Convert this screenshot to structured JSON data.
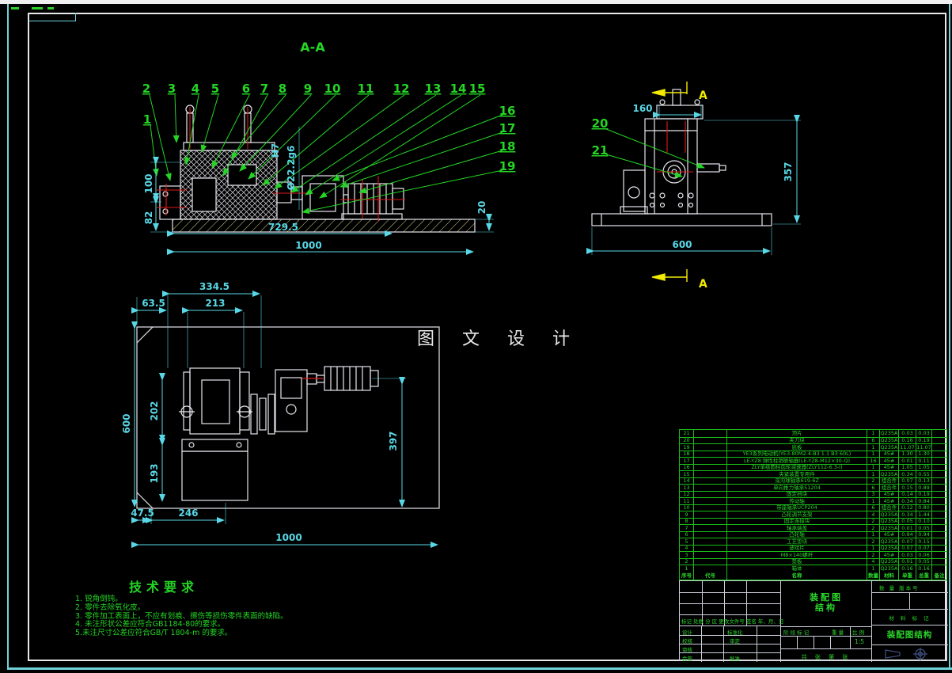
{
  "drawing": {
    "section": {
      "title": "A-A",
      "callouts": [
        "1",
        "2",
        "3",
        "4",
        "5",
        "6",
        "7",
        "8",
        "9",
        "10",
        "11",
        "12",
        "13",
        "14",
        "15",
        "16",
        "17",
        "18",
        "19"
      ],
      "dims": {
        "left_upper": "100",
        "left_lower": "82",
        "bottom_inner": "729.5",
        "bottom_outer": "1000",
        "right_thk": "20",
        "fit_upper": "H7",
        "fit_bore": "Ø22.2g6"
      }
    },
    "side": {
      "callouts": [
        "20",
        "21"
      ],
      "dims": {
        "top": "160",
        "right": "357",
        "bottom": "600"
      },
      "mark": "A"
    },
    "plan": {
      "dims": {
        "top_outer": "334.5",
        "top_left": "63.5",
        "top_right": "213",
        "left_outer": "600",
        "left_mid": "202",
        "left_low": "193",
        "bottom_a": "47.5",
        "bottom_b": "246",
        "bottom_outer": "1000",
        "right": "397"
      }
    },
    "watermark": "图 文 设 计"
  },
  "tech_req": {
    "title": "技术要求",
    "lines": [
      "1. 锐角倒钝。",
      "2. 零件去除氧化皮。",
      "3. 零件加工表面上，不应有划痕、擦伤等损伤零件表面的缺陷。",
      "4. 未注形状公差应符合GB1184-80的要求。",
      "5.未注尺寸公差应符合GB/T 1804-m 的要求。"
    ]
  },
  "parts": {
    "header_rows": [
      [
        "序号",
        "代号",
        "名称",
        "数量",
        "材料",
        "单重",
        "总重",
        "备注"
      ]
    ],
    "rows": [
      {
        "no": "21",
        "code": "",
        "name": "顶片",
        "qty": "1",
        "material": "Q235A",
        "unit_weight": "0.03",
        "total_weight": "0.03",
        "remark": ""
      },
      {
        "no": "20",
        "code": "",
        "name": "夹刀块",
        "qty": "6",
        "material": "Q235A",
        "unit_weight": "0.16",
        "total_weight": "0.19",
        "remark": ""
      },
      {
        "no": "19",
        "code": "",
        "name": "底板",
        "qty": "1",
        "material": "Q235A",
        "unit_weight": "11.07",
        "total_weight": "11.07",
        "remark": ""
      },
      {
        "no": "18",
        "code": "",
        "name": "YE3系列电动机(YE3-80M2-4-B3 1.1 B3 60L)",
        "qty": "1",
        "material": "45#",
        "unit_weight": "1.30",
        "total_weight": "1.30",
        "remark": ""
      },
      {
        "no": "17",
        "code": "",
        "name": "LE-YZ8 弹性柱销联轴器(LE-YZ8-M12×30-Q)",
        "qty": "16",
        "material": "45#",
        "unit_weight": "0.01",
        "total_weight": "0.11",
        "remark": ""
      },
      {
        "no": "16",
        "code": "",
        "name": "ZLY单级圆柱齿轮减速器(ZLY112-6.3-Ⅰ)",
        "qty": "1",
        "material": "45#",
        "unit_weight": "1.05",
        "total_weight": "1.05",
        "remark": ""
      },
      {
        "no": "15",
        "code": "",
        "name": "夹紧装置专用件",
        "qty": "1",
        "material": "Q235A",
        "unit_weight": "0.34",
        "total_weight": "0.55",
        "remark": ""
      },
      {
        "no": "14",
        "code": "",
        "name": "深沟球轴承619-6Z",
        "qty": "2",
        "material": "组合件",
        "unit_weight": "0.07",
        "total_weight": "0.13",
        "remark": ""
      },
      {
        "no": "13",
        "code": "",
        "name": "单向推力轴承51204",
        "qty": "6",
        "material": "组合件",
        "unit_weight": "0.15",
        "total_weight": "0.89",
        "remark": ""
      },
      {
        "no": "12",
        "code": "",
        "name": "固定挡块",
        "qty": "3",
        "material": "45#",
        "unit_weight": "0.14",
        "total_weight": "0.19",
        "remark": ""
      },
      {
        "no": "11",
        "code": "",
        "name": "传动轴",
        "qty": "1",
        "material": "45#",
        "unit_weight": "0.34",
        "total_weight": "0.84",
        "remark": ""
      },
      {
        "no": "10",
        "code": "",
        "name": "带座轴承UCP204",
        "qty": "6",
        "material": "组合件",
        "unit_weight": "0.12",
        "total_weight": "0.80",
        "remark": ""
      },
      {
        "no": "9",
        "code": "",
        "name": "凸轮调节支架",
        "qty": "4",
        "material": "Q235A",
        "unit_weight": "0.34",
        "total_weight": "1.44",
        "remark": ""
      },
      {
        "no": "8",
        "code": "",
        "name": "固定连接块",
        "qty": "2",
        "material": "Q235A",
        "unit_weight": "0.05",
        "total_weight": "0.10",
        "remark": ""
      },
      {
        "no": "7",
        "code": "",
        "name": "轴承端盖",
        "qty": "2",
        "material": "Q235A",
        "unit_weight": "0.01",
        "total_weight": "0.05",
        "remark": ""
      },
      {
        "no": "6",
        "code": "",
        "name": "凸轮轴",
        "qty": "1",
        "material": "45#",
        "unit_weight": "0.94",
        "total_weight": "0.94",
        "remark": ""
      },
      {
        "no": "5",
        "code": "",
        "name": "工艺垫块",
        "qty": "2",
        "material": "Q235A",
        "unit_weight": "0.07",
        "total_weight": "0.15",
        "remark": ""
      },
      {
        "no": "4",
        "code": "",
        "name": "波纹片",
        "qty": "1",
        "material": "Q235A",
        "unit_weight": "0.07",
        "total_weight": "0.07",
        "remark": ""
      },
      {
        "no": "3",
        "code": "",
        "name": "M8×140螺杆",
        "qty": "2",
        "material": "45#",
        "unit_weight": "0.03",
        "total_weight": "0.06",
        "remark": ""
      },
      {
        "no": "2",
        "code": "",
        "name": "垫板",
        "qty": "4",
        "material": "Q235A",
        "unit_weight": "0.01",
        "total_weight": "0.05",
        "remark": ""
      },
      {
        "no": "1",
        "code": "",
        "name": "箱体",
        "qty": "1",
        "material": "Q235A",
        "unit_weight": "0.16",
        "total_weight": "0.16",
        "remark": ""
      }
    ]
  },
  "title_block": {
    "revision_header": "标记 处数 分 区 更改文件号 签名 年、月、日",
    "design": "设计",
    "standardize": "标准化",
    "check": "校核",
    "approve_review": "审定",
    "audit": "审核",
    "countersign": "会签",
    "ratify": "批准",
    "stage_mark": "阶 段 标 记",
    "weight": "重 量",
    "scale": "比 例",
    "scale_value": "1:5",
    "sheets": "共  张  第  张",
    "name_line1": "装配图",
    "name_line2": "结构",
    "qty_version": "数 量 版本号",
    "material_mark": "材 料 标 记",
    "drawing_no": "装配图结构",
    "projection_icons": [
      "cone-projection-icon",
      "target-circle-icon"
    ]
  }
}
